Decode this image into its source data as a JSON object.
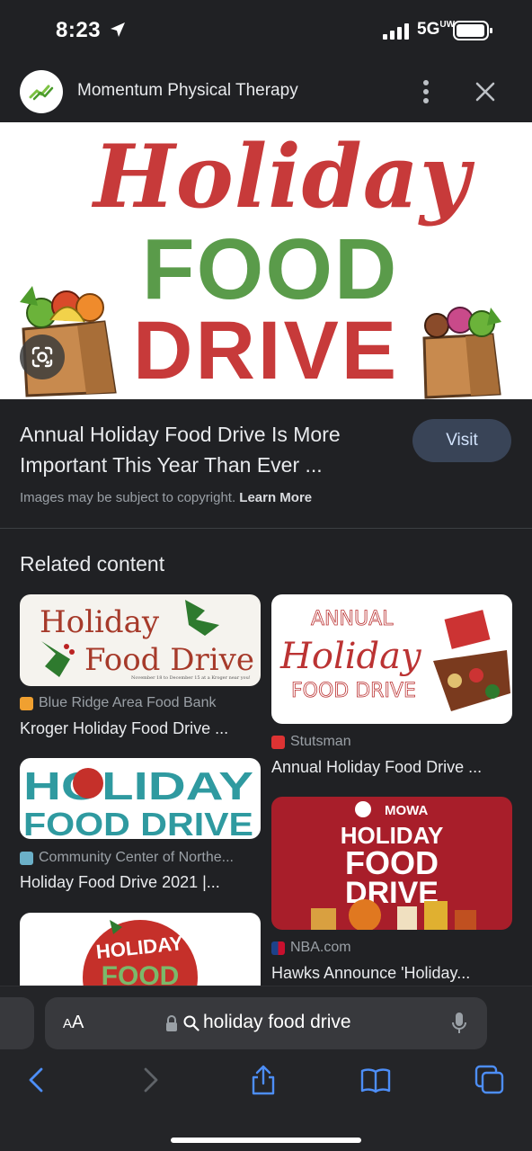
{
  "status_bar": {
    "time": "8:23",
    "network": "5GUW",
    "network_label": "5G"
  },
  "source": {
    "name": "Momentum Physical Therapy"
  },
  "hero": {
    "line1": "Holiday",
    "line2": "FOOD",
    "line3": "DRIVE"
  },
  "result": {
    "title": "Annual Holiday Food Drive Is More Important This Year Than Ever ...",
    "visit_label": "Visit",
    "copyright": "Images may be subject to copyright.",
    "learn_more": "Learn More"
  },
  "related": {
    "heading": "Related content",
    "items": [
      {
        "source": "Blue Ridge Area Food Bank",
        "title": "Kroger Holiday Food Drive ...",
        "img_line1": "Holiday",
        "img_line2": "Food Drive",
        "img_sub": "November 18 to December 15 at a Kroger near you!"
      },
      {
        "source": "Stutsman",
        "title": "Annual Holiday Food Drive ...",
        "img_line1": "ANNUAL",
        "img_line2": "Holiday",
        "img_line3": "FOOD DRIVE"
      },
      {
        "source": "Community Center of Northe...",
        "title": "Holiday Food Drive 2021 |...",
        "img_line1": "HOLIDAY",
        "img_line2": "FOOD DRIVE"
      },
      {
        "source": "NBA.com",
        "title": "Hawks Announce 'Holiday...",
        "img_brand": "MOWA",
        "img_line1": "HOLIDAY",
        "img_line2": "FOOD",
        "img_line3": "DRIVE"
      },
      {
        "img_line1": "HOLIDAY",
        "img_line2": "FOOD"
      }
    ]
  },
  "browser": {
    "text_size_label": "AA",
    "query": "holiday food drive"
  },
  "colors": {
    "accent_blue": "#4d8ef7",
    "hero_red": "#c73a3a",
    "hero_green": "#5a9b4a",
    "visit_bg": "#394457"
  }
}
